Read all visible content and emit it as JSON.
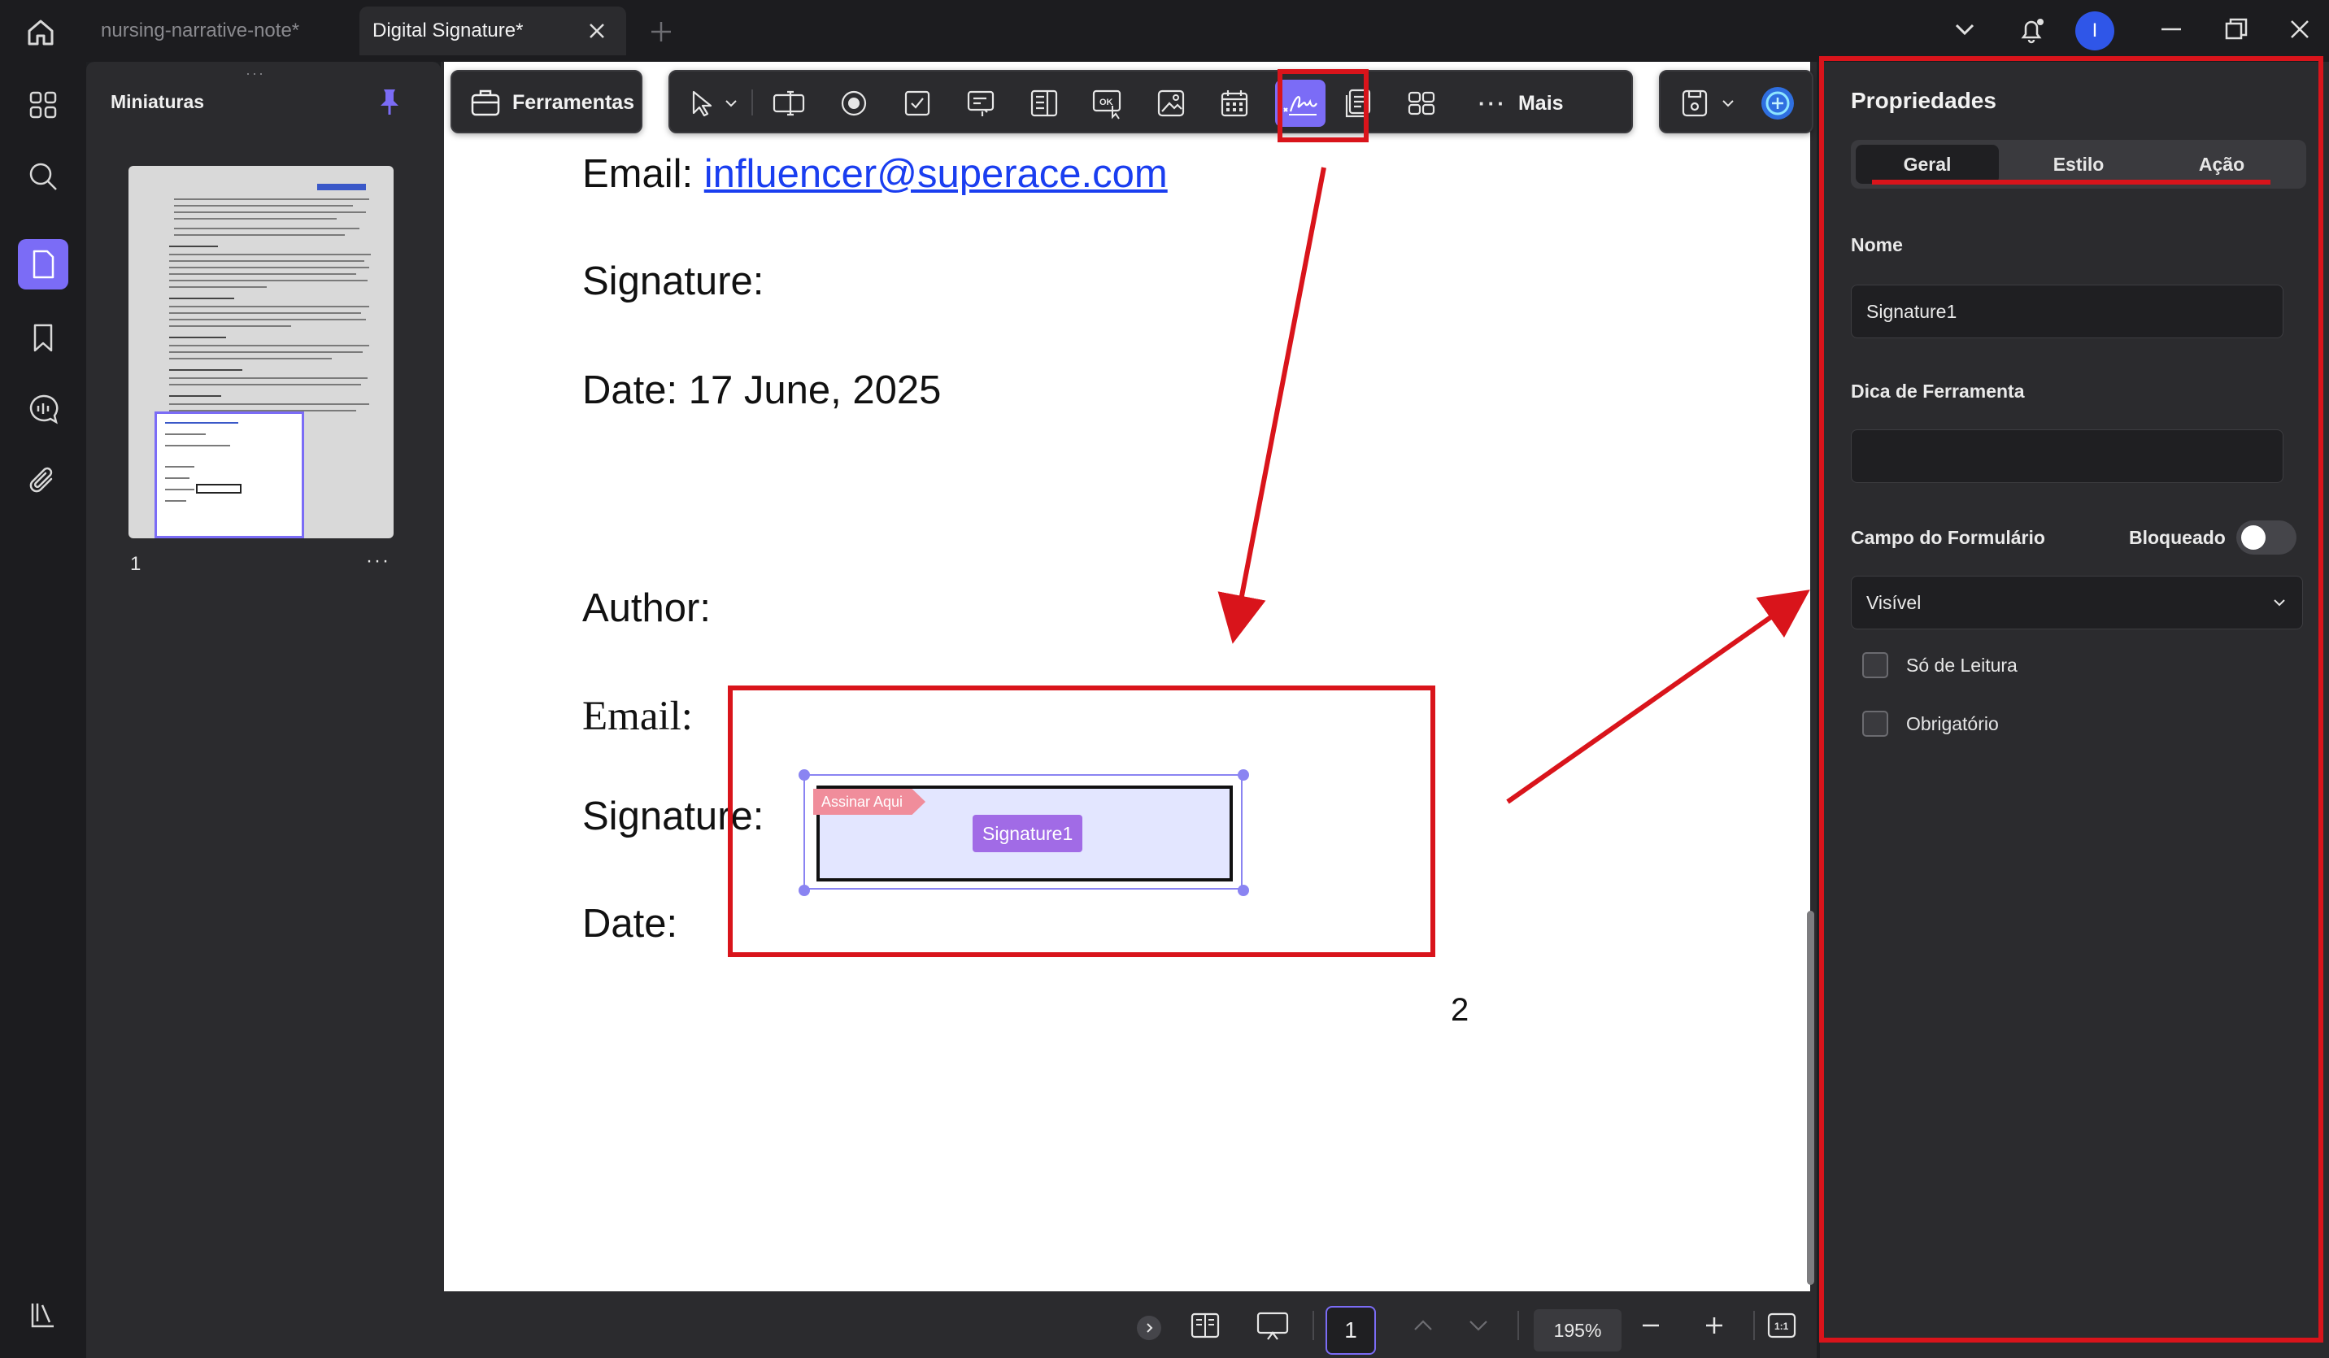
{
  "titlebar": {
    "tabs": [
      {
        "label": "nursing-narrative-note*",
        "active": false
      },
      {
        "label": "Digital Signature*",
        "active": true
      }
    ],
    "avatar_initial": "I"
  },
  "sidebar": {
    "title": "Miniaturas",
    "page_number": "1",
    "more": "···"
  },
  "toolbar": {
    "tools_label": "Ferramentas",
    "more_label": "Mais"
  },
  "document": {
    "line_email_top_label": "Email:",
    "line_email_top_link": "influencer@superace.com",
    "line_signature_top": "Signature:",
    "line_date_top": "Date: 17 June, 2025",
    "line_author": "Author:",
    "line_email_bottom": "Email:",
    "line_signature_bottom": "Signature:",
    "line_date_bottom": "Date:",
    "page_footer_number": "2"
  },
  "signature_field": {
    "sign_here_tag": "Assinar Aqui",
    "name_tag": "Signature1"
  },
  "statusbar": {
    "page_input": "1",
    "zoom": "195%"
  },
  "properties": {
    "title": "Propriedades",
    "tabs": [
      "Geral",
      "Estilo",
      "Ação"
    ],
    "active_tab": "Geral",
    "name_label": "Nome",
    "name_value": "Signature1",
    "tooltip_label": "Dica de Ferramenta",
    "tooltip_value": "",
    "form_field_label": "Campo do Formulário",
    "locked_label": "Bloqueado",
    "visibility_value": "Visível",
    "readonly_label": "Só de Leitura",
    "required_label": "Obrigatório"
  },
  "colors": {
    "accent": "#7b6cf6",
    "annotation_red": "#d9141b",
    "link_blue": "#1a3ef0"
  }
}
